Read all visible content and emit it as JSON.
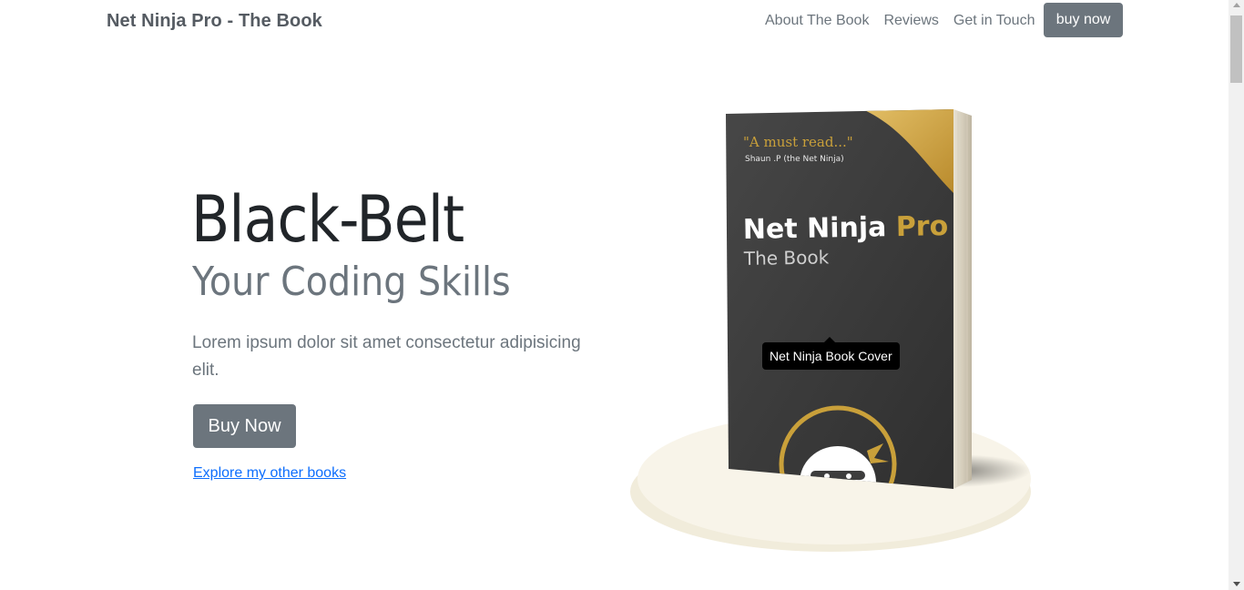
{
  "navbar": {
    "brand": "Net Ninja Pro - The Book",
    "links": [
      "About The Book",
      "Reviews",
      "Get in Touch"
    ],
    "buy_label": "buy now"
  },
  "hero": {
    "title": "Black-Belt",
    "subtitle": "Your Coding Skills",
    "lead": "Lorem ipsum dolor sit amet consectetur adipisicing elit.",
    "buy_label": "Buy Now",
    "explore_link": "Explore my other books"
  },
  "book_cover": {
    "quote": "\"A must read...\"",
    "quote_author": "Shaun .P (the Net Ninja)",
    "title_main": "Net Ninja",
    "title_accent": "Pro",
    "subtitle": "The Book",
    "tooltip": "Net Ninja Book Cover"
  },
  "colors": {
    "secondary": "#6c757d",
    "link": "#0d6efd",
    "gold": "#c9a03a",
    "cover": "#3d3d3d",
    "platform": "#f7f3e6"
  }
}
